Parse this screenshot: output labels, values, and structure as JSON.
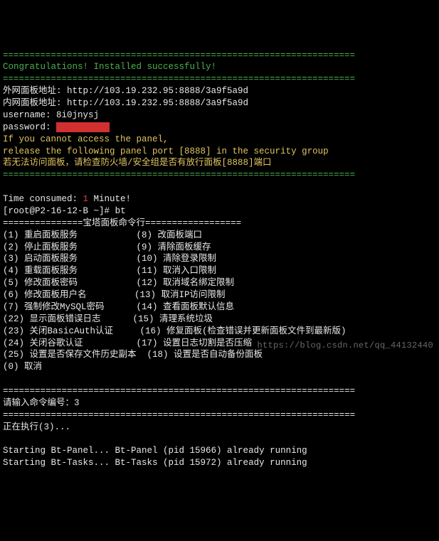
{
  "sep": "==================================================================",
  "congrats": "Congratulations! Installed successfully!",
  "labels": {
    "ext_panel": "外网面板地址: ",
    "int_panel": "内网面板地址: ",
    "username": "username: ",
    "password": "password: "
  },
  "urls": {
    "ext": "http://103.19.232.95:8888/3a9f5a9d",
    "int": "http://103.19.232.95:8888/3a9f5a9d"
  },
  "creds": {
    "user": "8i0jnysj",
    "pass_mask": "          "
  },
  "warn": {
    "l1": "If you cannot access the panel,",
    "l2": "release the following panel port [8888] in the security group",
    "l3": "若无法访问面板，请检查防火墙/安全组是否有放行面板[8888]端口"
  },
  "time": {
    "prefix": "Time consumed: ",
    "val": "1",
    "suffix": " Minute!"
  },
  "prompt": {
    "user_host": "[root@P2-16-12-B ",
    "tilde": "~",
    "tail": "]# ",
    "cmd": "bt"
  },
  "menu_title": {
    "pre": "===============",
    "txt": "宝塔面板命令行",
    "post": "=================="
  },
  "menu_lines": [
    "(1) 重启面板服务           (8) 改面板端口",
    "(2) 停止面板服务           (9) 清除面板缓存",
    "(3) 启动面板服务           (10) 清除登录限制",
    "(4) 重载面板服务           (11) 取消入口限制",
    "(5) 修改面板密码           (12) 取消域名绑定限制",
    "(6) 修改面板用户名         (13) 取消IP访问限制",
    "(7) 强制修改MySQL密码      (14) 查看面板默认信息",
    "(22) 显示面板错误日志      (15) 清理系统垃圾",
    "(23) 关闭BasicAuth认证     (16) 修复面板(检查错误并更新面板文件到最新版)",
    "(24) 关闭谷歌认证          (17) 设置日志切割是否压缩",
    "(25) 设置是否保存文件历史副本  (18) 设置是否自动备份面板",
    "(0) 取消"
  ],
  "input_prompt": "请输入命令编号：",
  "input_val": "3",
  "exec_line": "正在执行(3)...",
  "status": {
    "l1a": "Starting Bt-Panel...",
    "l1b": " Bt-Panel (pid 15966) already running",
    "l2a": "Starting Bt-Tasks...",
    "l2b": " Bt-Tasks (pid 15972) already running"
  },
  "watermark": "https://blog.csdn.net/qq_44132440"
}
